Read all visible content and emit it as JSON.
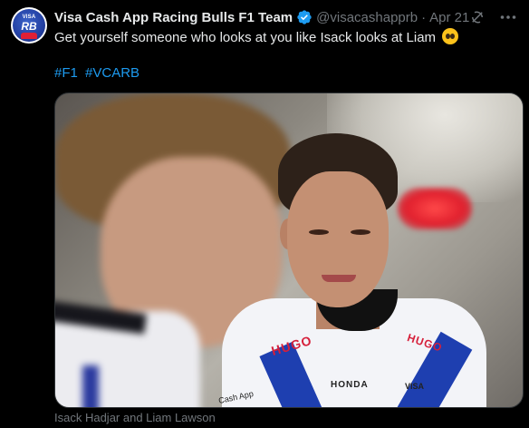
{
  "tweet": {
    "avatar": {
      "line1": "VISA",
      "line2": "RB"
    },
    "display_name": "Visa Cash App Racing Bulls F1 Team",
    "handle": "@visacashapprb",
    "separator": "·",
    "date": "Apr 21",
    "text": "Get yourself someone who looks at you like Isack looks at Liam",
    "text_emoji": "pleading-face-emoji",
    "hashtags": [
      "#F1",
      "#VCARB"
    ],
    "media": {
      "shirt_text_left": "HUGO",
      "shirt_text_right": "HUGO",
      "shirt_text_sponsor": "HONDA",
      "shirt_text_visa": "VISA",
      "shirt_text_cashapp": "Cash App"
    },
    "caption": "Isack Hadjar and Liam Lawson"
  },
  "icons": {
    "verified": "verified-badge-icon",
    "grok": "grok-icon",
    "more": "more-options-icon"
  },
  "colors": {
    "background": "#000000",
    "primary_text": "#e7e9ea",
    "secondary_text": "#71767b",
    "link": "#1d9bf0",
    "verified": "#1d9bf0"
  }
}
